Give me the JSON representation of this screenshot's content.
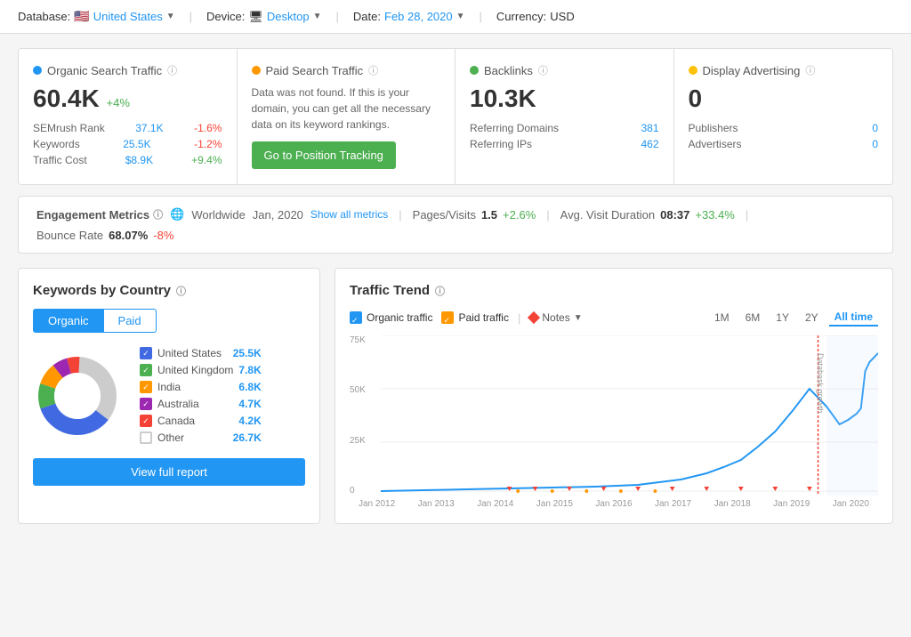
{
  "topbar": {
    "database_label": "Database:",
    "database_value": "United States",
    "device_label": "Device:",
    "device_value": "Desktop",
    "date_label": "Date:",
    "date_value": "Feb 28, 2020",
    "currency_label": "Currency:",
    "currency_value": "USD"
  },
  "cards": {
    "organic": {
      "title": "Organic Search Traffic",
      "value": "60.4K",
      "change": "+4%",
      "rows": [
        {
          "label": "SEMrush Rank",
          "val": "37.1K",
          "change": "-1.6%"
        },
        {
          "label": "Keywords",
          "val": "25.5K",
          "change": "-1.2%"
        },
        {
          "label": "Traffic Cost",
          "val": "$8.9K",
          "change": "+9.4%"
        }
      ]
    },
    "paid": {
      "title": "Paid Search Traffic",
      "no_data": "Data was not found. If this is your domain, you can get all the necessary data on its keyword rankings.",
      "button": "Go to Position Tracking"
    },
    "backlinks": {
      "title": "Backlinks",
      "value": "10.3K",
      "rows": [
        {
          "label": "Referring Domains",
          "val": "381"
        },
        {
          "label": "Referring IPs",
          "val": "462"
        }
      ]
    },
    "display": {
      "title": "Display Advertising",
      "value": "0",
      "rows": [
        {
          "label": "Publishers",
          "val": "0"
        },
        {
          "label": "Advertisers",
          "val": "0"
        }
      ]
    }
  },
  "engagement": {
    "title": "Engagement Metrics",
    "globe": "🌐",
    "location": "Worldwide",
    "date": "Jan, 2020",
    "show_all": "Show all metrics",
    "metrics": [
      {
        "label": "Pages/Visits",
        "value": "1.5",
        "change": "+2.6%",
        "positive": true
      },
      {
        "label": "Avg. Visit Duration",
        "value": "08:37",
        "change": "+33.4%",
        "positive": true
      },
      {
        "label": "Bounce Rate",
        "value": "68.07%",
        "change": "-8%",
        "positive": false
      }
    ]
  },
  "keywords_by_country": {
    "title": "Keywords by Country",
    "toggle_organic": "Organic",
    "toggle_paid": "Paid",
    "countries": [
      {
        "name": "United States",
        "value": "25.5K",
        "color": "#4169E1",
        "checked": true
      },
      {
        "name": "United Kingdom",
        "value": "7.8K",
        "color": "#4CAF50",
        "checked": true
      },
      {
        "name": "India",
        "value": "6.8K",
        "color": "#FF9800",
        "checked": true
      },
      {
        "name": "Australia",
        "value": "4.7K",
        "color": "#9C27B0",
        "checked": true
      },
      {
        "name": "Canada",
        "value": "4.2K",
        "color": "#f44336",
        "checked": true
      },
      {
        "name": "Other",
        "value": "26.7K",
        "color": "#ccc",
        "checked": false
      }
    ],
    "view_report": "View full report"
  },
  "traffic_trend": {
    "title": "Traffic Trend",
    "legend_organic": "Organic traffic",
    "legend_paid": "Paid traffic",
    "notes_label": "Notes",
    "time_periods": [
      "1M",
      "6M",
      "1Y",
      "2Y",
      "All time"
    ],
    "active_period": "All time",
    "x_labels": [
      "Jan 2012",
      "Jan 2013",
      "Jan 2014",
      "Jan 2015",
      "Jan 2016",
      "Jan 2017",
      "Jan 2018",
      "Jan 2019",
      "Jan 2020"
    ],
    "y_labels": [
      "75K",
      "50K",
      "25K",
      "0"
    ],
    "databask_label": "Databask growth"
  }
}
